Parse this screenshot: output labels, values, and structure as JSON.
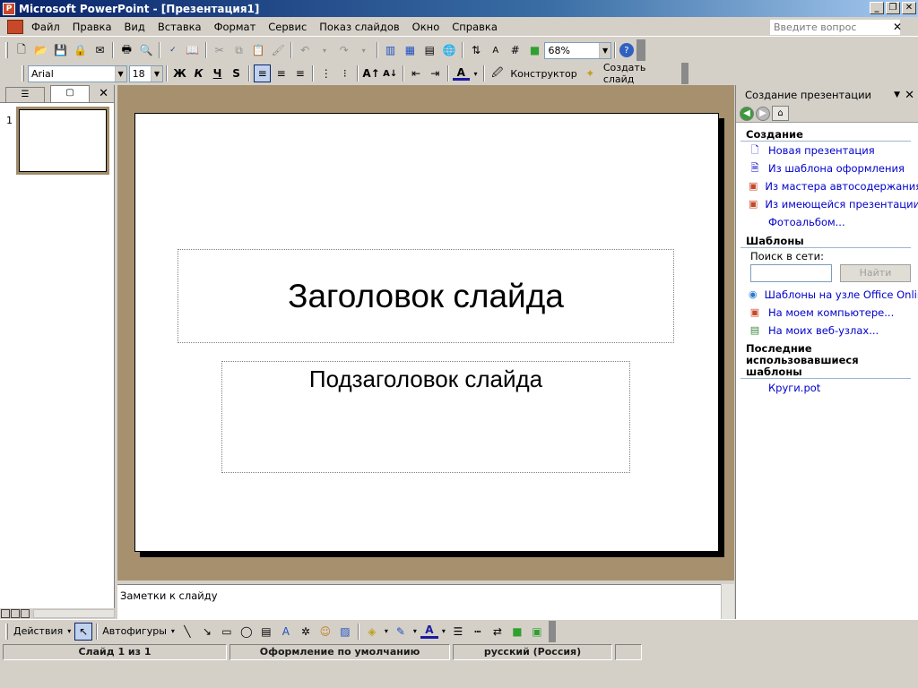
{
  "window": {
    "title": "Microsoft PowerPoint - [Презентация1]",
    "min_glyph": "_",
    "restore_glyph": "❐",
    "close_glyph": "✕"
  },
  "menu": {
    "items": [
      "Файл",
      "Правка",
      "Вид",
      "Вставка",
      "Формат",
      "Сервис",
      "Показ слайдов",
      "Окно",
      "Справка"
    ],
    "ask_placeholder": "Введите вопрос",
    "close_glyph": "✕"
  },
  "formatting": {
    "font": "Arial",
    "size": "18",
    "zoom": "68%",
    "bold": "Ж",
    "italic": "К",
    "underline": "Ч",
    "shadow": "S",
    "designer": "Конструктор",
    "new_slide": "Создать слайд"
  },
  "left_pane": {
    "slide_number": "1",
    "close_glyph": "✕"
  },
  "slide": {
    "title": "Заголовок слайда",
    "subtitle": "Подзаголовок слайда"
  },
  "notes": {
    "text": "Заметки к слайду"
  },
  "task_pane": {
    "title": "Создание презентации",
    "section_create": "Создание",
    "create_links": [
      "Новая презентация",
      "Из шаблона оформления",
      "Из мастера автосодержания...",
      "Из имеющейся презентации...",
      "Фотоальбом..."
    ],
    "section_templates": "Шаблоны",
    "search_label": "Поиск в сети:",
    "search_button": "Найти",
    "template_links": [
      "Шаблоны на узле Office Online",
      "На моем компьютере...",
      "На моих веб-узлах..."
    ],
    "section_recent": "Последние использовавшиеся шаблоны",
    "recent_links": [
      "Круги.pot"
    ]
  },
  "drawing": {
    "actions": "Действия",
    "autoshapes": "Автофигуры"
  },
  "status": {
    "slide": "Слайд 1 из 1",
    "design": "Оформление по умолчанию",
    "language": "русский (Россия)"
  },
  "colors": {
    "slide_background_area": "#a6906e",
    "title_bar": "#0a246a",
    "link": "#0000cc"
  }
}
